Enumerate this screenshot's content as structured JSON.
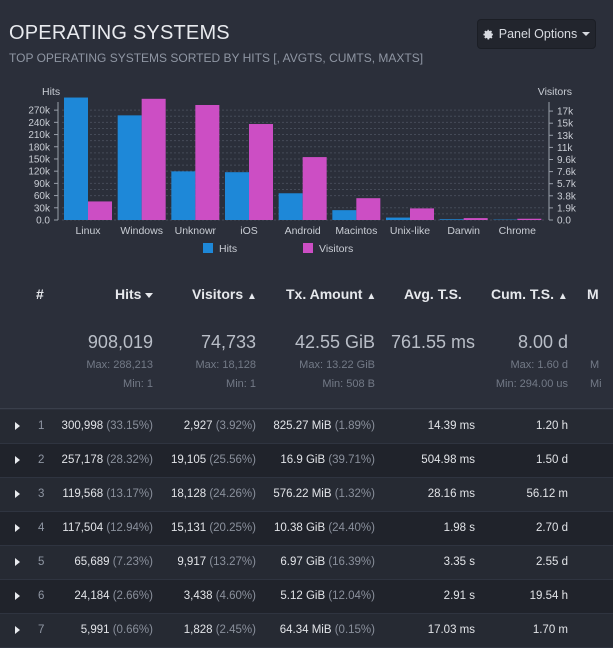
{
  "header": {
    "title": "OPERATING SYSTEMS",
    "subtitle": "TOP OPERATING SYSTEMS SORTED BY HITS [, AVGTS, CUMTS, MAXTS]"
  },
  "panel_options": {
    "label": "Panel Options",
    "icon": "gear-icon"
  },
  "chart_data": {
    "type": "bar",
    "categories": [
      "Linux",
      "Windows",
      "Unknowr",
      "iOS",
      "Android",
      "Macintos",
      "Unix-like",
      "Darwin",
      "Chrome"
    ],
    "series": [
      {
        "name": "Hits",
        "axis": "left",
        "color": "#1e88d8",
        "values": [
          300998,
          257178,
          119568,
          117504,
          65689,
          24184,
          5991,
          1800,
          900
        ]
      },
      {
        "name": "Visitors",
        "axis": "right",
        "color": "#cc4ec4",
        "values": [
          2927,
          19105,
          18128,
          15131,
          9917,
          3438,
          1828,
          300,
          200
        ]
      }
    ],
    "ylabel_left": "Hits",
    "ylabel_right": "Visitors",
    "left_ticks": [
      "0.0",
      "15k",
      "30k",
      "60k",
      "75k",
      "90k",
      "105k",
      "120k",
      "135k",
      "150k",
      "165k",
      "180k",
      "195k",
      "210k",
      "225k",
      "240k",
      "255k",
      "270k"
    ],
    "left_tick_values": [
      0,
      15000,
      30000,
      60000,
      75000,
      90000,
      105000,
      120000,
      135000,
      150000,
      165000,
      180000,
      195000,
      210000,
      225000,
      240000,
      255000,
      270000
    ],
    "left_labels_shown": [
      "0.0",
      "30k",
      "60k",
      "90k",
      "120k",
      "150k",
      "180k",
      "210k",
      "240k",
      "270k"
    ],
    "right_labels_shown": [
      "0.0",
      "1.9k",
      "3.8k",
      "5.7k",
      "7.6k",
      "9.6k",
      "11k",
      "13k",
      "15k",
      "17k"
    ],
    "left_ylim": [
      0,
      290000
    ],
    "right_ylim": [
      0,
      18600
    ],
    "grid": true,
    "legend": "bottom"
  },
  "table": {
    "columns": [
      {
        "label": "#",
        "sort": ""
      },
      {
        "label": "Hits",
        "sort": "down"
      },
      {
        "label": "Visitors",
        "sort": "both"
      },
      {
        "label": "Tx. Amount",
        "sort": "both"
      },
      {
        "label": "Avg. T.S.",
        "sort": ""
      },
      {
        "label": "Cum. T.S.",
        "sort": "both"
      },
      {
        "label": "M",
        "sort": ""
      }
    ],
    "summary": {
      "hits": {
        "total": "908,019",
        "max": "Max: 288,213",
        "min": "Min: 1"
      },
      "visitors": {
        "total": "74,733",
        "max": "Max: 18,128",
        "min": "Min: 1"
      },
      "tx": {
        "total": "42.55 GiB",
        "max": "Max: 13.22 GiB",
        "min": "Min: 508 B"
      },
      "avg": {
        "total": "761.55 ms"
      },
      "cum": {
        "total": "8.00 d",
        "max": "Max: 1.60 d",
        "min": "Min: 294.00 us"
      },
      "max_col": {
        "max": "M",
        "min": "Mi"
      }
    },
    "rows": [
      {
        "idx": "1",
        "hits": "300,998",
        "hits_pct": "(33.15%)",
        "visitors": "2,927",
        "visitors_pct": "(3.92%)",
        "tx": "825.27 MiB",
        "tx_pct": "(1.89%)",
        "avg": "14.39 ms",
        "cum": "1.20 h"
      },
      {
        "idx": "2",
        "hits": "257,178",
        "hits_pct": "(28.32%)",
        "visitors": "19,105",
        "visitors_pct": "(25.56%)",
        "tx": "16.9 GiB",
        "tx_pct": "(39.71%)",
        "avg": "504.98 ms",
        "cum": "1.50 d"
      },
      {
        "idx": "3",
        "hits": "119,568",
        "hits_pct": "(13.17%)",
        "visitors": "18,128",
        "visitors_pct": "(24.26%)",
        "tx": "576.22 MiB",
        "tx_pct": "(1.32%)",
        "avg": "28.16 ms",
        "cum": "56.12 m"
      },
      {
        "idx": "4",
        "hits": "117,504",
        "hits_pct": "(12.94%)",
        "visitors": "15,131",
        "visitors_pct": "(20.25%)",
        "tx": "10.38 GiB",
        "tx_pct": "(24.40%)",
        "avg": "1.98 s",
        "cum": "2.70 d"
      },
      {
        "idx": "5",
        "hits": "65,689",
        "hits_pct": "(7.23%)",
        "visitors": "9,917",
        "visitors_pct": "(13.27%)",
        "tx": "6.97 GiB",
        "tx_pct": "(16.39%)",
        "avg": "3.35 s",
        "cum": "2.55 d"
      },
      {
        "idx": "6",
        "hits": "24,184",
        "hits_pct": "(2.66%)",
        "visitors": "3,438",
        "visitors_pct": "(4.60%)",
        "tx": "5.12 GiB",
        "tx_pct": "(12.04%)",
        "avg": "2.91 s",
        "cum": "19.54 h"
      },
      {
        "idx": "7",
        "hits": "5,991",
        "hits_pct": "(0.66%)",
        "visitors": "1,828",
        "visitors_pct": "(2.45%)",
        "tx": "64.34 MiB",
        "tx_pct": "(0.15%)",
        "avg": "17.03 ms",
        "cum": "1.70 m"
      }
    ]
  }
}
